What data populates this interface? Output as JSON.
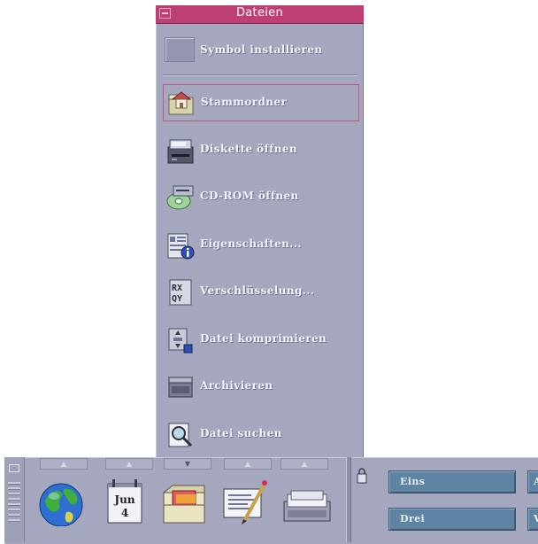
{
  "subpanel": {
    "title": "Dateien",
    "install_label": "Symbol installieren",
    "items": [
      {
        "label": "Stammordner",
        "icon": "home-folder-icon"
      },
      {
        "label": "Diskette öffnen",
        "icon": "floppy-drive-icon"
      },
      {
        "label": "CD-ROM öffnen",
        "icon": "cdrom-icon"
      },
      {
        "label": "Eigenschaften...",
        "icon": "properties-icon"
      },
      {
        "label": "Verschlüsselung...",
        "icon": "encryption-icon"
      },
      {
        "label": "Datei komprimieren",
        "icon": "compress-icon"
      },
      {
        "label": "Archivieren",
        "icon": "archive-icon"
      },
      {
        "label": "Datei suchen",
        "icon": "find-file-icon"
      }
    ]
  },
  "frontpanel": {
    "controls": [
      {
        "name": "globe-icon"
      },
      {
        "name": "calendar-icon",
        "month": "Jun",
        "day": "4"
      },
      {
        "name": "file-manager-icon"
      },
      {
        "name": "text-editor-icon"
      },
      {
        "name": "mail-icon"
      }
    ],
    "workspaces": [
      {
        "label": "Eins"
      },
      {
        "label": "A"
      },
      {
        "label": "Drei"
      },
      {
        "label": "V"
      }
    ]
  },
  "colors": {
    "panel": "#a5a7bf",
    "title_bar": "#bd3f73",
    "workspace_button": "#5f84a3",
    "selection_border": "#b25b7a"
  }
}
